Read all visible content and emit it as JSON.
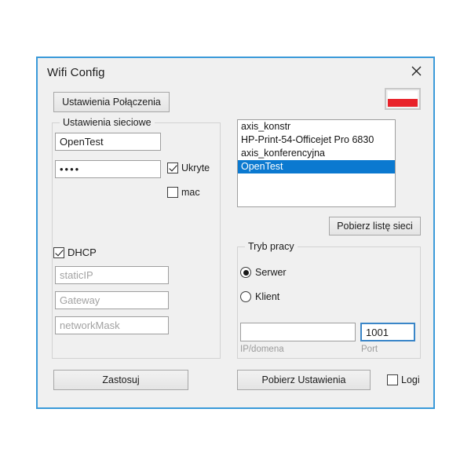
{
  "window": {
    "title": "Wifi Config",
    "close_icon": "close-icon"
  },
  "toolbar": {
    "connection_settings_label": "Ustawienia Połączenia",
    "flag_icon": "poland-flag-icon",
    "flag_colors": {
      "top": "#ffffff",
      "bottom": "#e8222a"
    }
  },
  "network_settings": {
    "legend": "Ustawienia sieciowe",
    "ssid_value": "OpenTest",
    "password_value": "••••",
    "hidden_checkbox": {
      "label": "Ukryte",
      "checked": true
    },
    "mac_checkbox": {
      "label": "mac",
      "checked": false
    },
    "dhcp_checkbox": {
      "label": "DHCP",
      "checked": true
    },
    "static_ip_placeholder": "staticIP",
    "gateway_placeholder": "Gateway",
    "network_mask_placeholder": "networkMask"
  },
  "network_list": {
    "items": [
      {
        "name": "axis_konstr",
        "selected": false
      },
      {
        "name": "HP-Print-54-Officejet Pro 6830",
        "selected": false
      },
      {
        "name": "axis_konferencyjna",
        "selected": false
      },
      {
        "name": "OpenTest",
        "selected": true
      }
    ],
    "selection_color": "#0b79d0",
    "refresh_button_label": "Pobierz listę sieci"
  },
  "work_mode": {
    "legend": "Tryb pracy",
    "server_radio": {
      "label": "Serwer",
      "selected": true
    },
    "client_radio": {
      "label": "Klient",
      "selected": false
    },
    "ip_domain_value": "",
    "ip_domain_caption": "IP/domena",
    "port_value": "1001",
    "port_caption": "Port",
    "port_focus_color": "#3a86c8"
  },
  "footer": {
    "apply_label": "Zastosuj",
    "get_settings_label": "Pobierz Ustawienia",
    "logs_checkbox": {
      "label": "Logi",
      "checked": false
    }
  }
}
